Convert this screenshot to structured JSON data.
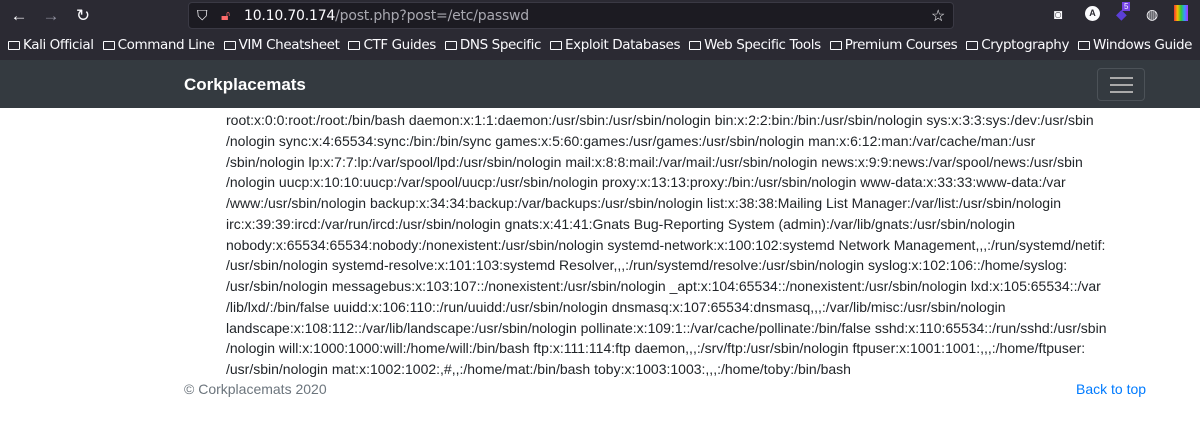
{
  "browser": {
    "url_host": "10.10.70.174",
    "url_path": "/post.php?post=/etc/passwd",
    "extension_badge": "5",
    "bookmarks": [
      "Kali Official",
      "Command Line",
      "VIM Cheatsheet",
      "CTF Guides",
      "DNS Specific",
      "Exploit Databases",
      "Web Specific Tools",
      "Premium Courses",
      "Cryptography",
      "Windows Guide"
    ]
  },
  "navbar": {
    "brand": "Corkplacemats"
  },
  "content": {
    "lines": [
      "root:x:0:0:root:/root:/bin/bash daemon:x:1:1:daemon:/usr/sbin:/usr/sbin/nologin bin:x:2:2:bin:/bin:/usr/sbin/nologin sys:x:3:3:sys:/dev:/usr/sbin",
      "/nologin sync:x:4:65534:sync:/bin:/bin/sync games:x:5:60:games:/usr/games:/usr/sbin/nologin man:x:6:12:man:/var/cache/man:/usr",
      "/sbin/nologin lp:x:7:7:lp:/var/spool/lpd:/usr/sbin/nologin mail:x:8:8:mail:/var/mail:/usr/sbin/nologin news:x:9:9:news:/var/spool/news:/usr/sbin",
      "/nologin uucp:x:10:10:uucp:/var/spool/uucp:/usr/sbin/nologin proxy:x:13:13:proxy:/bin:/usr/sbin/nologin www-data:x:33:33:www-data:/var",
      "/www:/usr/sbin/nologin backup:x:34:34:backup:/var/backups:/usr/sbin/nologin list:x:38:38:Mailing List Manager:/var/list:/usr/sbin/nologin",
      "irc:x:39:39:ircd:/var/run/ircd:/usr/sbin/nologin gnats:x:41:41:Gnats Bug-Reporting System (admin):/var/lib/gnats:/usr/sbin/nologin",
      "nobody:x:65534:65534:nobody:/nonexistent:/usr/sbin/nologin systemd-network:x:100:102:systemd Network Management,,,:/run/systemd/netif:",
      "/usr/sbin/nologin systemd-resolve:x:101:103:systemd Resolver,,,:/run/systemd/resolve:/usr/sbin/nologin syslog:x:102:106::/home/syslog:",
      "/usr/sbin/nologin messagebus:x:103:107::/nonexistent:/usr/sbin/nologin _apt:x:104:65534::/nonexistent:/usr/sbin/nologin lxd:x:105:65534::/var",
      "/lib/lxd/:/bin/false uuidd:x:106:110::/run/uuidd:/usr/sbin/nologin dnsmasq:x:107:65534:dnsmasq,,,:/var/lib/misc:/usr/sbin/nologin",
      "landscape:x:108:112::/var/lib/landscape:/usr/sbin/nologin pollinate:x:109:1::/var/cache/pollinate:/bin/false sshd:x:110:65534::/run/sshd:/usr/sbin",
      "/nologin will:x:1000:1000:will:/home/will:/bin/bash ftp:x:111:114:ftp daemon,,,:/srv/ftp:/usr/sbin/nologin ftpuser:x:1001:1001:,,,:/home/ftpuser:",
      "/usr/sbin/nologin mat:x:1002:1002:,#,,:/home/mat:/bin/bash toby:x:1003:1003:,,,:/home/toby:/bin/bash"
    ]
  },
  "footer": {
    "copyright": "© Corkplacemats 2020",
    "back_to_top": "Back to top"
  }
}
